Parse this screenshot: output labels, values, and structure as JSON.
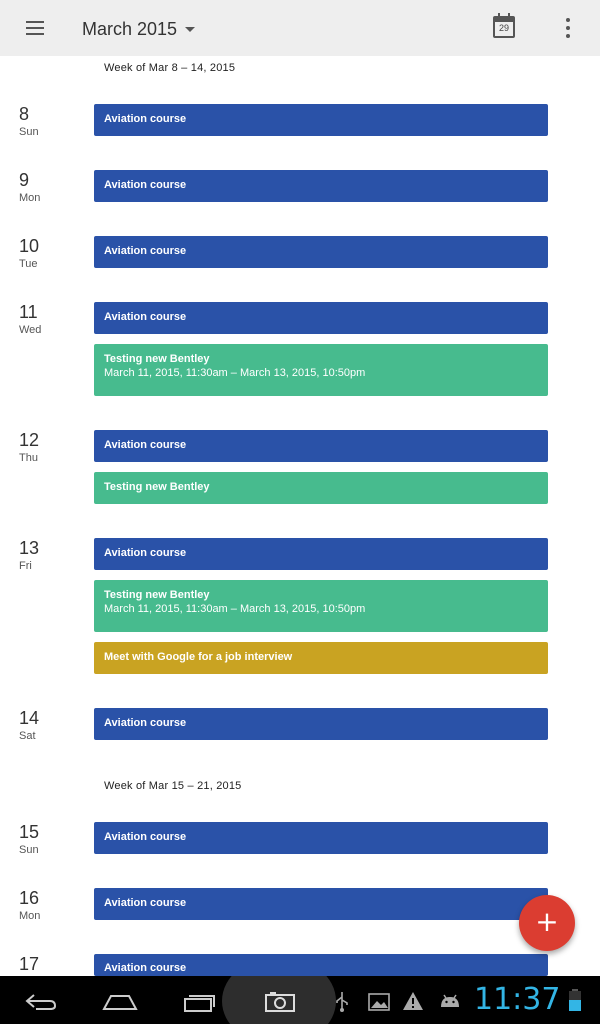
{
  "appbar": {
    "title": "March 2015",
    "today_day": "29",
    "icons": [
      "menu-icon",
      "dropdown-caret-icon",
      "calendar-today-icon",
      "more-vert-icon"
    ]
  },
  "agenda": {
    "week1": "Week of Mar 8 – 14, 2015",
    "week2": "Week of Mar 15 – 21, 2015",
    "days": [
      {
        "num": "8",
        "name": "Sun"
      },
      {
        "num": "9",
        "name": "Mon"
      },
      {
        "num": "10",
        "name": "Tue"
      },
      {
        "num": "11",
        "name": "Wed"
      },
      {
        "num": "12",
        "name": "Thu"
      },
      {
        "num": "13",
        "name": "Fri"
      },
      {
        "num": "14",
        "name": "Sat"
      },
      {
        "num": "15",
        "name": "Sun"
      },
      {
        "num": "16",
        "name": "Mon"
      },
      {
        "num": "17",
        "name": ""
      }
    ],
    "events": [
      {
        "title": "Aviation course",
        "color": "#2a52a8"
      },
      {
        "title": "Testing new Bentley",
        "time": "March 11, 2015, 11:30am – March 13, 2015, 10:50pm",
        "color": "#47bb8e"
      },
      {
        "title": "Meet with Google for a job interview",
        "color": "#c9a322"
      }
    ]
  },
  "fab": {
    "label": "+",
    "color": "#db3d31"
  },
  "system_bar": {
    "clock": "11:37",
    "clock_color": "#33b5e5",
    "icons": [
      "back-icon",
      "home-icon",
      "recent-apps-icon",
      "camera-icon",
      "usb-icon",
      "image-icon",
      "warning-icon",
      "android-icon",
      "battery-icon"
    ]
  }
}
